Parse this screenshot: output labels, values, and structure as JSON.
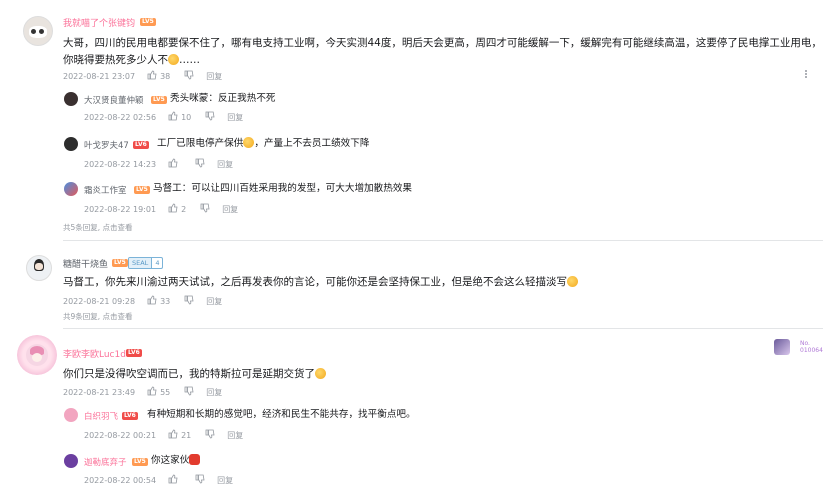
{
  "icons": {
    "like": "thumb-up-icon",
    "dislike": "thumb-down-icon",
    "more": "more-vertical-icon"
  },
  "colors": {
    "vip_name": "#fb7299",
    "normal_name": "#61666d",
    "meta": "#9499a0",
    "lv5": "#ff9a52",
    "lv6": "#f04c49"
  },
  "comments": [
    {
      "user": "我就喵了个张键钧",
      "level": "LV5",
      "text": "大哥，四川的民用电都要保不住了，哪有电支持工业啊，今天实测44度，明后天会更高，周四才可能缓解一下，缓解完有可能继续高温，这要停了民电撑工业用电，你晓得要热死多少人不",
      "text_tail": "……",
      "time": "2022-08-21 23:07",
      "likes": "38",
      "reply": "回复",
      "replies": [
        {
          "user": "大汉贤良董仲颖",
          "level": "LV5",
          "mention": "秃头咪蒙",
          "text": "：反正我热不死",
          "time": "2022-08-22 02:56",
          "likes": "10",
          "reply": "回复"
        },
        {
          "user": "叶戈罗夫47",
          "level": "LV6",
          "text": "工厂已限电停产保供",
          "text_tail": "，产量上不去员工绩效下降",
          "time": "2022-08-22 14:23",
          "likes": "",
          "reply": "回复"
        },
        {
          "user": "霜炎工作室",
          "level": "LV5",
          "mention": "马督工",
          "text": "：可以让四川百姓采用我的发型，可大大增加散热效果",
          "time": "2022-08-22 19:01",
          "likes": "2",
          "reply": "回复"
        }
      ],
      "more": "共5条回复, 点击查看"
    },
    {
      "user": "糖醋干烧鱼",
      "level": "LV5",
      "badge": "SEAL",
      "badge_level": "4",
      "text": "马督工，你先来川渝过两天试试，之后再发表你的言论，可能你还是会坚持保工业，但是绝不会这么轻描淡写",
      "time": "2022-08-21 09:28",
      "likes": "33",
      "reply": "回复",
      "more": "共9条回复, 点击查看"
    },
    {
      "user": "李欧李欧Luc1d",
      "level": "LV6",
      "text": "你们只是没得吹空调而已，我的特斯拉可是延期交货了",
      "time": "2022-08-21 23:49",
      "likes": "55",
      "reply": "回复",
      "fan_no": "No.",
      "fan_num": "010064",
      "replies": [
        {
          "user": "白织羽飞",
          "level": "LV6",
          "text": "有种短期和长期的感觉吧，经济和民生不能共存，找平衡点吧。",
          "time": "2022-08-22 00:21",
          "likes": "21",
          "reply": "回复"
        },
        {
          "user": "迦勒底弃子",
          "level": "LV5",
          "text": "你这家伙",
          "time": "2022-08-22 00:54",
          "likes": "",
          "reply": "回复"
        }
      ]
    }
  ]
}
